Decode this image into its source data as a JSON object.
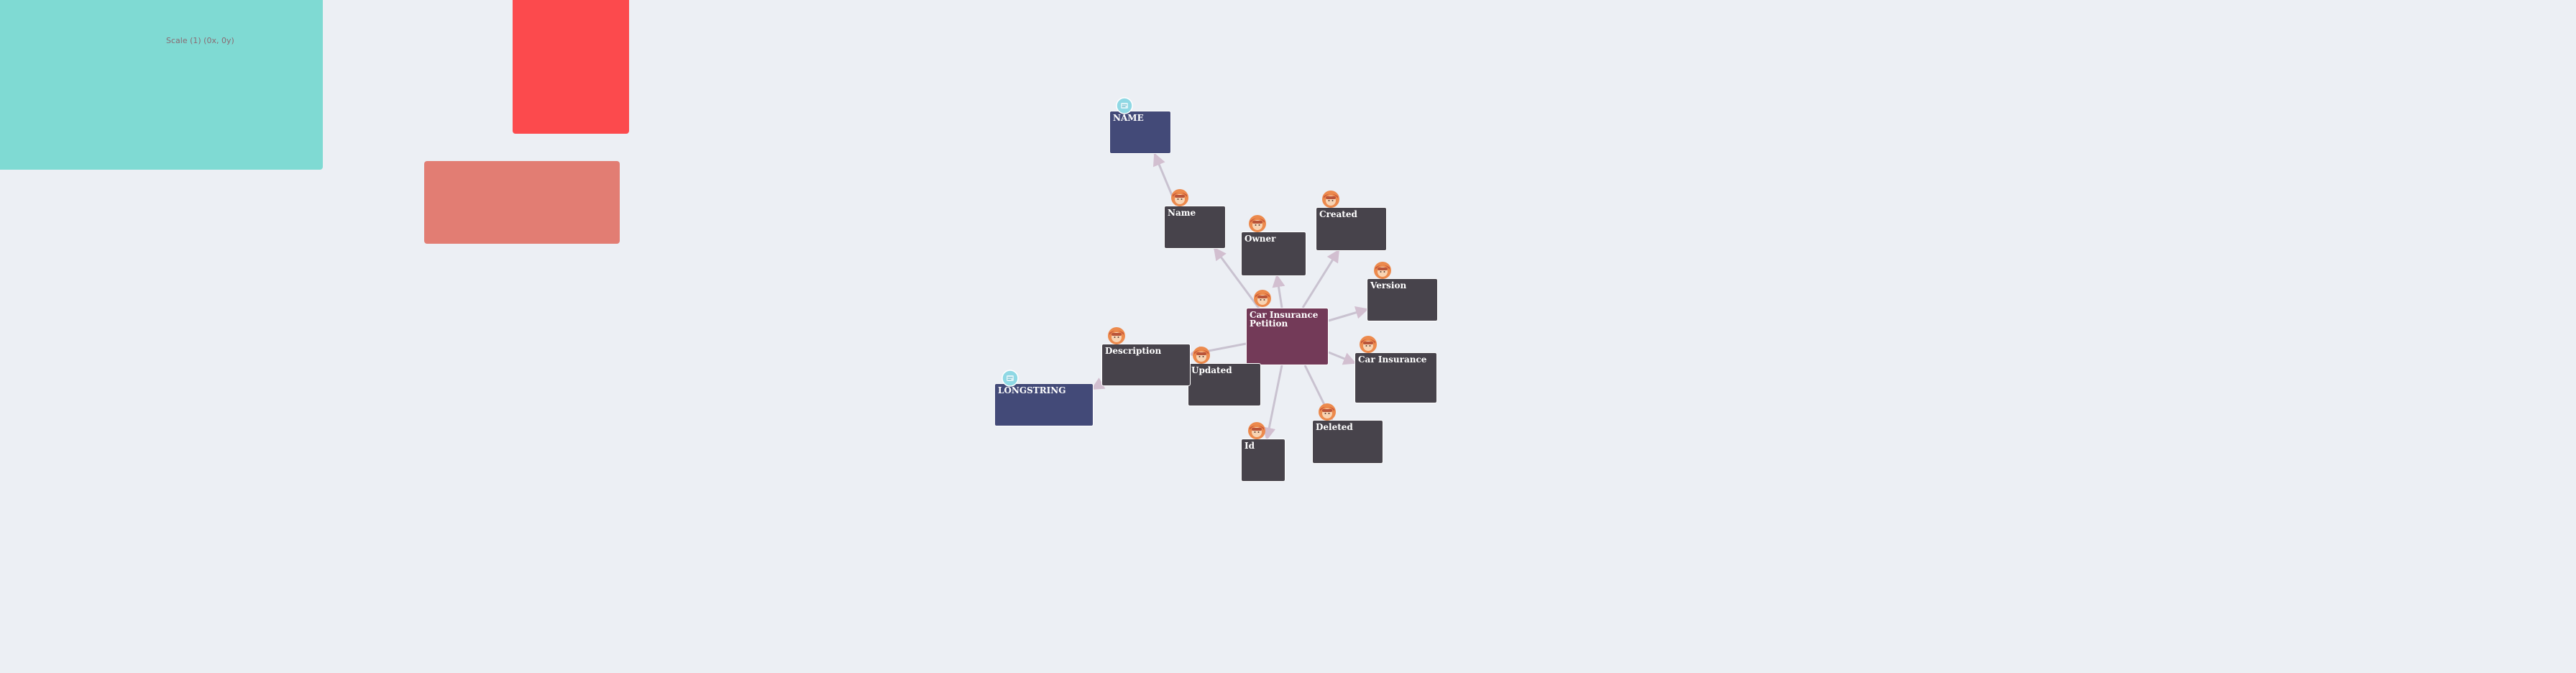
{
  "scale_label": "Scale (1) (0x, 0y)",
  "colors": {
    "background": "#eceff4",
    "scale_panel": "#7fdad3",
    "red_panel": "#fc4a4d",
    "salmon_panel": "#e27d73",
    "root_node": "#733a58",
    "property_node": "#47434b",
    "type_node": "#434a78",
    "edge": "#c9c2d0"
  },
  "graph": {
    "root": {
      "id": "root",
      "label": "Car Insurance Petition",
      "avatar": "person-icon"
    },
    "properties": [
      {
        "id": "name",
        "label": "Name"
      },
      {
        "id": "owner",
        "label": "Owner"
      },
      {
        "id": "created",
        "label": "Created"
      },
      {
        "id": "version",
        "label": "Version"
      },
      {
        "id": "car_insurance",
        "label": "Car Insurance"
      },
      {
        "id": "deleted",
        "label": "Deleted"
      },
      {
        "id": "id",
        "label": "Id"
      },
      {
        "id": "updated",
        "label": "Updated"
      },
      {
        "id": "description",
        "label": "Description"
      }
    ],
    "types": [
      {
        "id": "name_type",
        "label": "NAME",
        "of": "name"
      },
      {
        "id": "longstring_type",
        "label": "LONGSTRING",
        "of": "description"
      }
    ]
  }
}
